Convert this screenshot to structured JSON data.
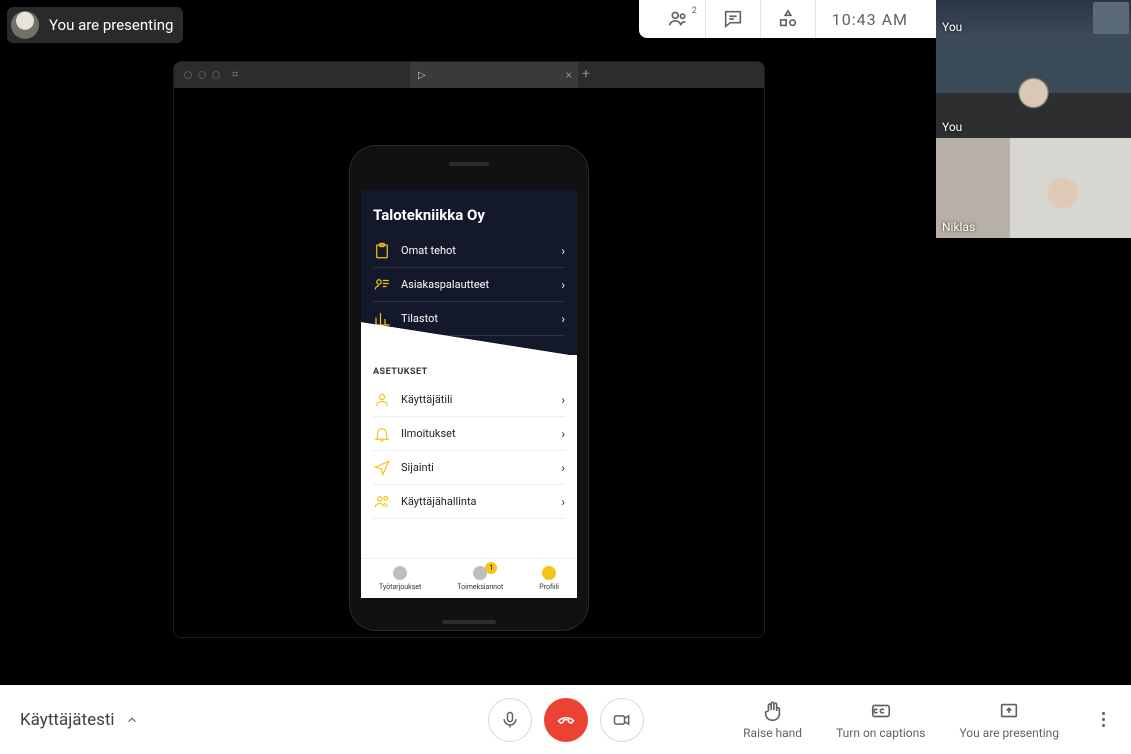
{
  "presenting_pill": "You are presenting",
  "top_toolbar": {
    "people_count": "2",
    "time": "10:43  AM"
  },
  "thumbs": [
    {
      "label": "You"
    },
    {
      "label": "You"
    },
    {
      "label": "Niklas"
    }
  ],
  "app": {
    "title": "Talotekniikka Oy",
    "dark_items": [
      {
        "label": "Omat tehot"
      },
      {
        "label": "Asiakaspalautteet"
      },
      {
        "label": "Tilastot"
      }
    ],
    "section_label": "ASETUKSET",
    "light_items": [
      {
        "label": "Käyttäjätili"
      },
      {
        "label": "Ilmoitukset"
      },
      {
        "label": "Sijainti"
      },
      {
        "label": "Käyttäjähallinta"
      }
    ],
    "tabs": [
      {
        "label": "Työtarjoukset",
        "badge": ""
      },
      {
        "label": "Toimeksiannot",
        "badge": "1"
      },
      {
        "label": "Profiili",
        "badge": ""
      }
    ]
  },
  "bottom": {
    "meeting_name": "Käyttäjätesti",
    "raise_hand": "Raise hand",
    "captions": "Turn on captions",
    "presenting": "You are presenting"
  }
}
